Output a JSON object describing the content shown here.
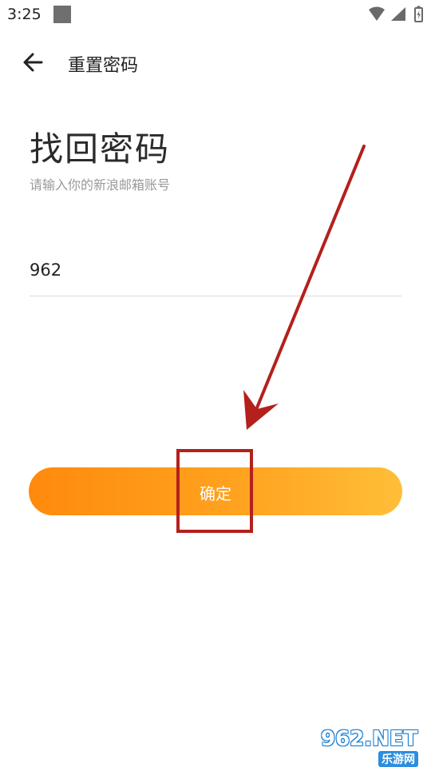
{
  "status_bar": {
    "time": "3:25",
    "icons": [
      "wifi-icon",
      "cellular-signal-icon",
      "battery-charging-icon"
    ]
  },
  "app_bar": {
    "back_icon": "arrow-left-icon",
    "title": "重置密码"
  },
  "content": {
    "heading": "找回密码",
    "subtitle": "请输入你的新浪邮箱账号",
    "input_value": "962"
  },
  "confirm_button": {
    "label": "确定",
    "gradient_start": "#ff8a0d",
    "gradient_end": "#ffbe38"
  },
  "annotation": {
    "color": "#b4201c"
  },
  "watermark": {
    "top": "962.NET",
    "bottom": "乐游网"
  }
}
